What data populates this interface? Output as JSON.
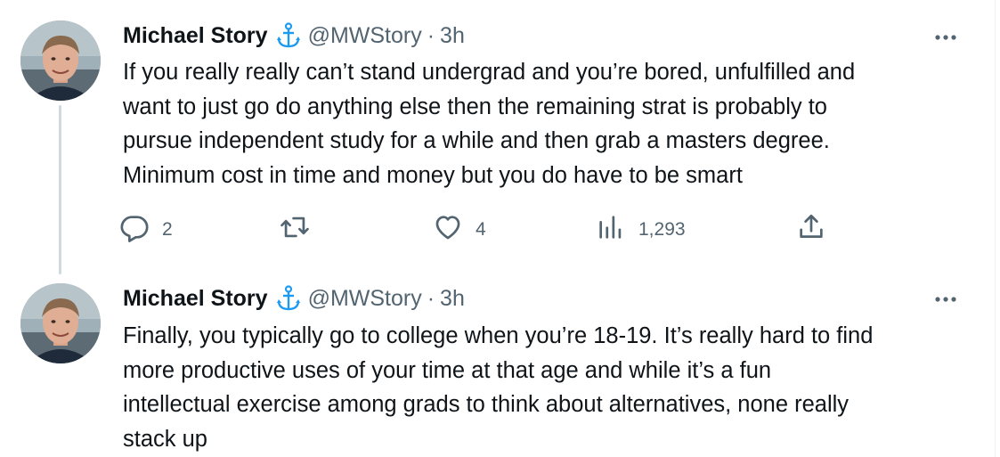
{
  "thread": {
    "tweets": [
      {
        "author_name": "Michael Story",
        "author_badge_icon": "anchor-icon",
        "handle": "@MWStory",
        "separator": "·",
        "time": "3h",
        "text": "If you really really can’t stand undergrad and you’re bored, unfulfilled and\nwant to just go do anything else then the remaining strat is probably to\npursue independent study for a while and then grab a masters degree.\nMinimum cost in time and money but you do have to be smart",
        "actions": {
          "replies": "2",
          "retweets": "",
          "likes": "4",
          "views": "1,293"
        }
      },
      {
        "author_name": "Michael Story",
        "author_badge_icon": "anchor-icon",
        "handle": "@MWStory",
        "separator": "·",
        "time": "3h",
        "text": "Finally, you typically go to college when you’re 18-19. It’s really hard to find\nmore productive uses of your time at that age and while it’s a fun\nintellectual exercise among grads to think about alternatives, none really\nstack up"
      }
    ]
  },
  "colors": {
    "text_primary": "#0f1419",
    "text_secondary": "#536471",
    "accent_blue": "#1d9bf0",
    "thread_line": "#cfd9de"
  },
  "icons": [
    "reply-icon",
    "retweet-icon",
    "like-icon",
    "views-icon",
    "share-icon",
    "more-icon",
    "anchor-icon"
  ]
}
